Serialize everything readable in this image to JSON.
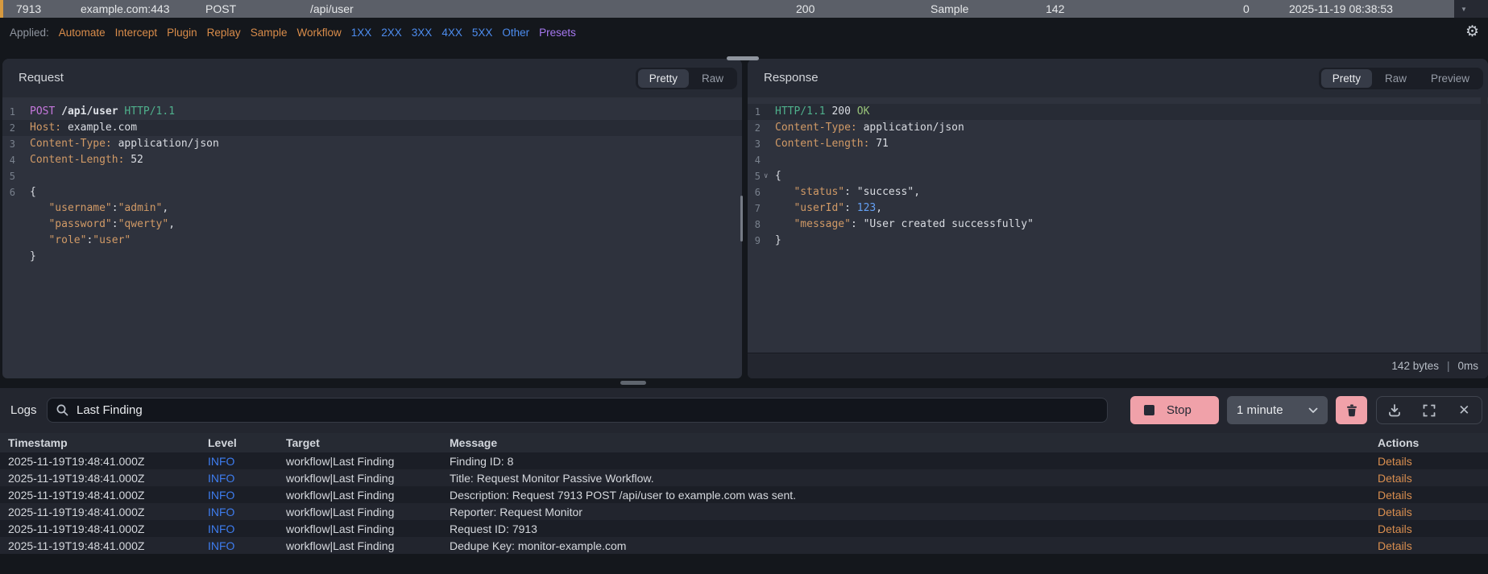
{
  "history_row": {
    "id": "7913",
    "host": "example.com:443",
    "method": "POST",
    "path": "/api/user",
    "status": "200",
    "source": "Sample",
    "length": "142",
    "zero": "0",
    "timestamp": "2025-11-19 08:38:53"
  },
  "applied_bar": {
    "label": "Applied:",
    "filters": [
      {
        "label": "Automate",
        "color": "#d98c4a"
      },
      {
        "label": "Intercept",
        "color": "#d98c4a"
      },
      {
        "label": "Plugin",
        "color": "#d98c4a"
      },
      {
        "label": "Replay",
        "color": "#d98c4a"
      },
      {
        "label": "Sample",
        "color": "#d98c4a"
      },
      {
        "label": "Workflow",
        "color": "#d98c4a"
      },
      {
        "label": "1XX",
        "color": "#4d8df0"
      },
      {
        "label": "2XX",
        "color": "#4d8df0"
      },
      {
        "label": "3XX",
        "color": "#4d8df0"
      },
      {
        "label": "4XX",
        "color": "#4d8df0"
      },
      {
        "label": "5XX",
        "color": "#4d8df0"
      },
      {
        "label": "Other",
        "color": "#4d8df0"
      },
      {
        "label": "Presets",
        "color": "#a678f0"
      }
    ]
  },
  "request_panel": {
    "title": "Request",
    "tabs": [
      {
        "label": "Pretty",
        "active": true
      },
      {
        "label": "Raw",
        "active": false
      }
    ],
    "code": [
      {
        "n": "1",
        "tok": [
          [
            "POST ",
            "m"
          ],
          [
            "/api/user ",
            "b"
          ],
          [
            "HTTP/1.1",
            "h"
          ]
        ]
      },
      {
        "n": "2",
        "hl": true,
        "tok": [
          [
            "Host:",
            "k"
          ],
          [
            " example.com",
            "v"
          ]
        ]
      },
      {
        "n": "3",
        "tok": [
          [
            "Content-Type:",
            "k"
          ],
          [
            " application/json",
            "v"
          ]
        ]
      },
      {
        "n": "4",
        "tok": [
          [
            "Content-Length:",
            "k"
          ],
          [
            " 52",
            "v"
          ]
        ]
      },
      {
        "n": "5",
        "tok": []
      },
      {
        "n": "6",
        "tok": [
          [
            "{",
            "v"
          ]
        ]
      },
      {
        "tok": [
          [
            "   ",
            "v"
          ],
          [
            "\"username\"",
            "k"
          ],
          [
            ":",
            "v"
          ],
          [
            "\"admin\"",
            "k"
          ],
          [
            ",",
            "v"
          ]
        ]
      },
      {
        "tok": [
          [
            "   ",
            "v"
          ],
          [
            "\"password\"",
            "k"
          ],
          [
            ":",
            "v"
          ],
          [
            "\"qwerty\"",
            "k"
          ],
          [
            ",",
            "v"
          ]
        ]
      },
      {
        "tok": [
          [
            "   ",
            "v"
          ],
          [
            "\"role\"",
            "k"
          ],
          [
            ":",
            "v"
          ],
          [
            "\"user\"",
            "k"
          ]
        ]
      },
      {
        "tok": [
          [
            "}",
            "v"
          ]
        ]
      }
    ]
  },
  "response_panel": {
    "title": "Response",
    "tabs": [
      {
        "label": "Pretty",
        "active": true
      },
      {
        "label": "Raw",
        "active": false
      },
      {
        "label": "Preview",
        "active": false
      }
    ],
    "code": [
      {
        "n": "1",
        "hl": true,
        "tok": [
          [
            "HTTP/1.1 ",
            "h"
          ],
          [
            "200 ",
            "v"
          ],
          [
            "OK",
            "g"
          ]
        ]
      },
      {
        "n": "2",
        "tok": [
          [
            "Content-Type:",
            "k"
          ],
          [
            " application/json",
            "v"
          ]
        ]
      },
      {
        "n": "3",
        "tok": [
          [
            "Content-Length:",
            "k"
          ],
          [
            " 71",
            "v"
          ]
        ]
      },
      {
        "n": "4",
        "tok": []
      },
      {
        "n": "5",
        "fold": true,
        "tok": [
          [
            "{",
            "v"
          ]
        ]
      },
      {
        "n": "6",
        "tok": [
          [
            "   ",
            "v"
          ],
          [
            "\"status\"",
            "k"
          ],
          [
            ": ",
            "v"
          ],
          [
            "\"success\"",
            "v"
          ],
          [
            ",",
            "v"
          ]
        ]
      },
      {
        "n": "7",
        "tok": [
          [
            "   ",
            "v"
          ],
          [
            "\"userId\"",
            "k"
          ],
          [
            ": ",
            "v"
          ],
          [
            "123",
            "n"
          ],
          [
            ",",
            "v"
          ]
        ]
      },
      {
        "n": "8",
        "tok": [
          [
            "   ",
            "v"
          ],
          [
            "\"message\"",
            "k"
          ],
          [
            ": ",
            "v"
          ],
          [
            "\"User created successfully\"",
            "v"
          ]
        ]
      },
      {
        "n": "9",
        "tok": [
          [
            "}",
            "v"
          ]
        ]
      }
    ],
    "status_bar": {
      "size": "142 bytes",
      "separator": "|",
      "time": "0ms"
    }
  },
  "logs": {
    "title": "Logs",
    "search_value": "Last Finding",
    "stop_label": "Stop",
    "interval_value": "1 minute",
    "table": {
      "headers": [
        "Timestamp",
        "Level",
        "Target",
        "Message",
        "Actions"
      ],
      "rows": [
        {
          "timestamp": "2025-11-19T19:48:41.000Z",
          "level": "INFO",
          "target": "workflow|Last Finding",
          "message": "Finding ID: 8",
          "action": "Details"
        },
        {
          "timestamp": "2025-11-19T19:48:41.000Z",
          "level": "INFO",
          "target": "workflow|Last Finding",
          "message": "Title: Request Monitor Passive Workflow.",
          "action": "Details"
        },
        {
          "timestamp": "2025-11-19T19:48:41.000Z",
          "level": "INFO",
          "target": "workflow|Last Finding",
          "message": "Description: Request 7913 POST /api/user to example.com was sent.",
          "action": "Details"
        },
        {
          "timestamp": "2025-11-19T19:48:41.000Z",
          "level": "INFO",
          "target": "workflow|Last Finding",
          "message": "Reporter: Request Monitor",
          "action": "Details"
        },
        {
          "timestamp": "2025-11-19T19:48:41.000Z",
          "level": "INFO",
          "target": "workflow|Last Finding",
          "message": "Request ID: 7913",
          "action": "Details"
        },
        {
          "timestamp": "2025-11-19T19:48:41.000Z",
          "level": "INFO",
          "target": "workflow|Last Finding",
          "message": "Dedupe Key: monitor-example.com",
          "action": "Details"
        }
      ]
    }
  },
  "colors": {
    "selected_row_gray": "#5b5f68",
    "row_accent_orange": "#d79a3f",
    "filter_orange": "#d98c4a",
    "filter_blue": "#4d8df0",
    "filter_purple": "#a678f0",
    "pink_button": "#f0a1a9",
    "info_blue": "#3e7df0",
    "details_orange": "#d98e4f",
    "code_key_orange": "#d19a66",
    "code_method_pink": "#c678dd",
    "code_http_teal": "#4fb08c",
    "code_ok_green": "#98c379",
    "code_number_blue": "#64a0f4"
  }
}
